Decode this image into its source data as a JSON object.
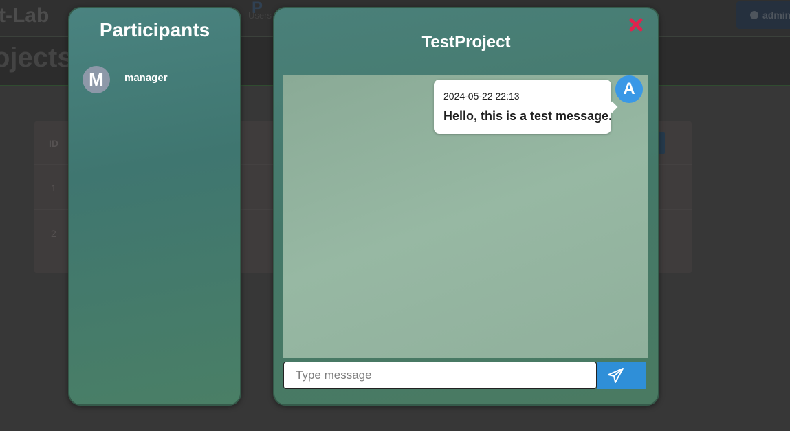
{
  "background": {
    "brand": "t-Lab",
    "nav_users_icon": "P",
    "nav_users": "Users",
    "admin_button": "admin",
    "page_heading": "ojects",
    "table": {
      "header_id": "ID",
      "rows": [
        "1",
        "2"
      ]
    }
  },
  "participants": {
    "title": "Participants",
    "items": [
      {
        "initial": "M",
        "name": "manager"
      }
    ]
  },
  "chat": {
    "title": "TestProject",
    "close_icon": "close-x-icon",
    "messages": [
      {
        "sender_initial": "A",
        "timestamp": "2024-05-22 22:13",
        "text": "Hello, this is a test message."
      }
    ],
    "input": {
      "value": "",
      "placeholder": "Type message"
    },
    "send_icon": "paper-plane-icon"
  },
  "colors": {
    "send_button": "#2f8fd8",
    "close_icon": "#e0234e",
    "avatar_self": "#3a98e6",
    "avatar_participant": "#8d98a8"
  }
}
